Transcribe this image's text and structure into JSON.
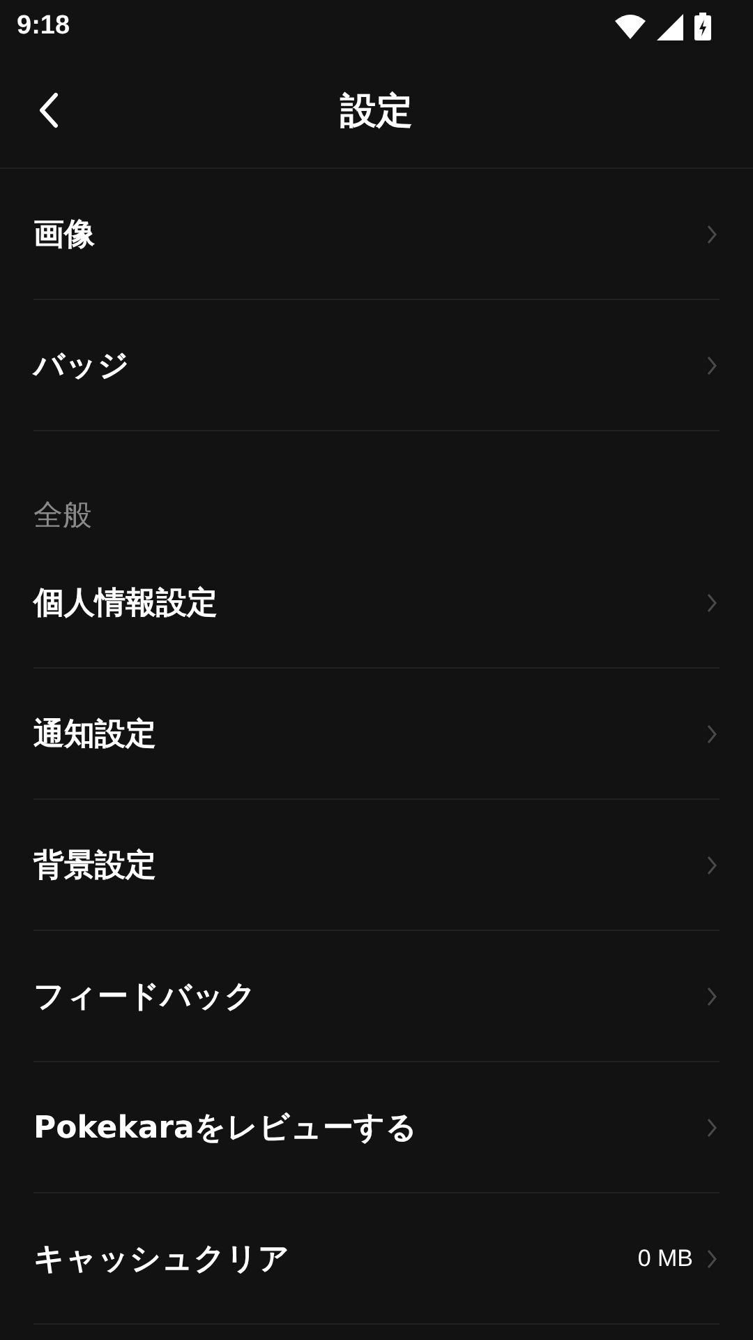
{
  "status_bar": {
    "time": "9:18"
  },
  "header": {
    "title": "設定"
  },
  "groups": [
    {
      "items": [
        {
          "label": "画像"
        },
        {
          "label": "バッジ"
        }
      ]
    },
    {
      "title": "全般",
      "items": [
        {
          "label": "個人情報設定"
        },
        {
          "label": "通知設定"
        },
        {
          "label": "背景設定"
        },
        {
          "label": "フィードバック"
        },
        {
          "label": "Pokekaraをレビューする"
        },
        {
          "label": "キャッシュクリア",
          "value": "0 MB"
        }
      ]
    }
  ]
}
